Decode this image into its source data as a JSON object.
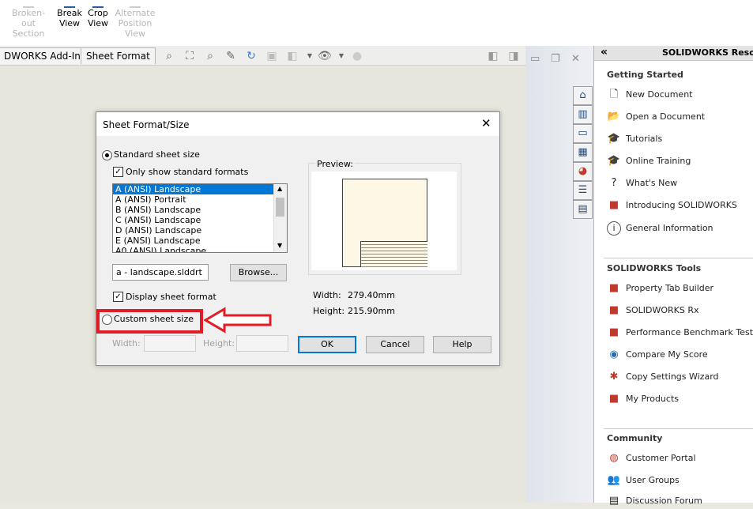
{
  "ribbon": {
    "broken_out": "Broken-out Section",
    "broken_out_l1": "Broken-out",
    "broken_out_l2": "Section",
    "break_l1": "Break",
    "break_l2": "View",
    "crop_l1": "Crop",
    "crop_l2": "View",
    "alt_l1": "Alternate",
    "alt_l2": "Position",
    "alt_l3": "View"
  },
  "tabs": {
    "addins": "DWORKS Add-Ins",
    "sheet_format": "Sheet Format"
  },
  "dialog": {
    "title": "Sheet Format/Size",
    "close": "✕",
    "standard_size": "Standard sheet size",
    "only_standard": "Only show standard formats",
    "sizes": [
      "A (ANSI) Landscape",
      "A (ANSI) Portrait",
      "B (ANSI) Landscape",
      "C (ANSI) Landscape",
      "D (ANSI) Landscape",
      "E (ANSI) Landscape",
      "A0 (ANSI) Landscape"
    ],
    "selected_size": "A (ANSI) Landscape",
    "format_file": "a - landscape.slddrt",
    "browse": "Browse...",
    "display_format": "Display sheet format",
    "custom_size": "Custom sheet size",
    "width_label": "Width:",
    "height_label": "Height:",
    "preview_label": "Preview:",
    "width_value_label": "Width:",
    "width_value": "279.40mm",
    "height_value_label": "Height:",
    "height_value": "215.90mm",
    "ok": "OK",
    "cancel": "Cancel",
    "help": "Help"
  },
  "taskpane": {
    "title": "SOLIDWORKS Resou",
    "collapse": "«",
    "getting_started": {
      "heading": "Getting Started",
      "items": [
        "New Document",
        "Open a Document",
        "Tutorials",
        "Online Training",
        "What's New",
        "Introducing SOLIDWORKS",
        "General Information"
      ]
    },
    "tools": {
      "heading": "SOLIDWORKS Tools",
      "items": [
        "Property Tab Builder",
        "SOLIDWORKS Rx",
        "Performance Benchmark Test",
        "Compare My Score",
        "Copy Settings Wizard",
        "My Products"
      ]
    },
    "community": {
      "heading": "Community",
      "items": [
        "Customer Portal",
        "User Groups",
        "Discussion Forum"
      ]
    }
  },
  "colors": {
    "accent": "#0078d7",
    "annotation": "#e01d24"
  }
}
